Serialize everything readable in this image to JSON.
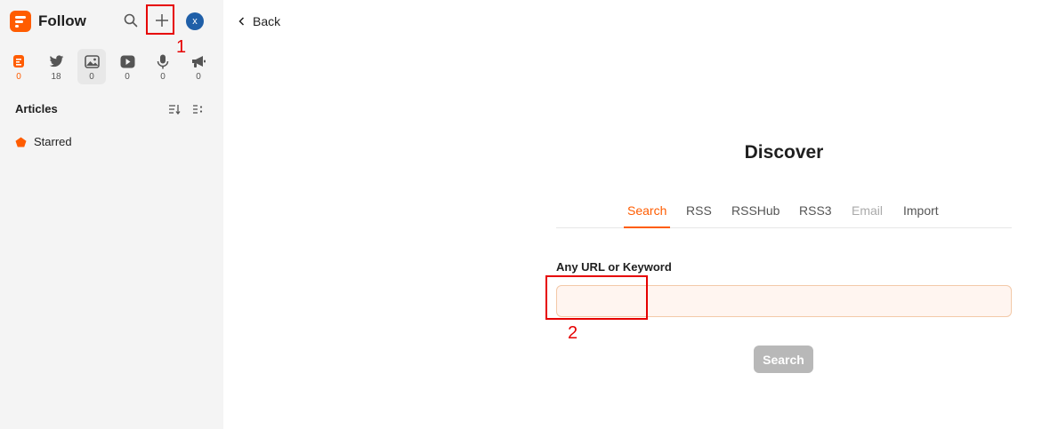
{
  "sidebar": {
    "brand": "Follow",
    "avatar_initial": "x",
    "views": [
      {
        "icon": "article-icon",
        "count": "0"
      },
      {
        "icon": "twitter-icon",
        "count": "18"
      },
      {
        "icon": "picture-icon",
        "count": "0"
      },
      {
        "icon": "video-icon",
        "count": "0"
      },
      {
        "icon": "microphone-icon",
        "count": "0"
      },
      {
        "icon": "megaphone-icon",
        "count": "0"
      }
    ],
    "section_title": "Articles",
    "starred_label": "Starred"
  },
  "annotations": [
    "1",
    "2"
  ],
  "main": {
    "back_label": "Back",
    "title": "Discover",
    "tabs": [
      {
        "label": "Search",
        "state": "active"
      },
      {
        "label": "RSS",
        "state": "normal"
      },
      {
        "label": "RSSHub",
        "state": "normal"
      },
      {
        "label": "RSS3",
        "state": "normal"
      },
      {
        "label": "Email",
        "state": "disabled"
      },
      {
        "label": "Import",
        "state": "normal"
      }
    ],
    "field_label": "Any URL or Keyword",
    "field_value": "",
    "search_button": "Search"
  },
  "colors": {
    "accent": "#ff5c00",
    "annotation": "#e60000",
    "avatar": "#1f5fa8",
    "sidebar_bg": "#f4f4f4",
    "button_disabled": "#b8b8b8"
  }
}
